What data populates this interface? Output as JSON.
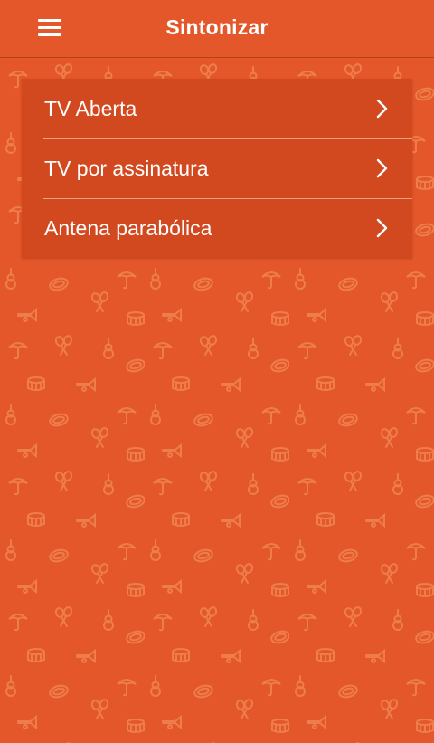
{
  "header": {
    "title": "Sintonizar",
    "menu_icon": "hamburger-menu-icon"
  },
  "list": {
    "items": [
      {
        "label": "TV Aberta",
        "icon": "chevron-right-icon"
      },
      {
        "label": "TV por assinatura",
        "icon": "chevron-right-icon"
      },
      {
        "label": "Antena parabólica",
        "icon": "chevron-right-icon"
      }
    ]
  },
  "colors": {
    "background": "#e4572a",
    "list_background": "#d3491f",
    "divider": "#f0a07f",
    "text": "#ffffff",
    "pattern": "#f08a55"
  },
  "background_pattern_icons": [
    "umbrella-icon",
    "maracas-icon",
    "guitar-icon",
    "drum-icon",
    "tambourine-icon",
    "trumpet-icon"
  ]
}
